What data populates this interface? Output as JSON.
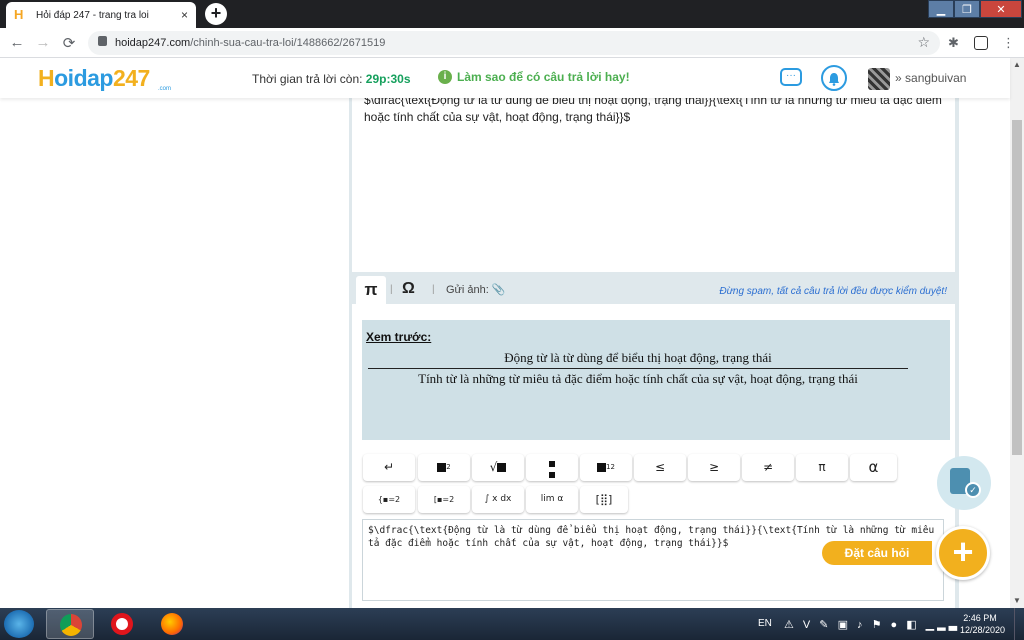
{
  "browser": {
    "tab_title": "Hỏi đáp 247 - trang tra loi",
    "tab_close": "×",
    "new_tab": "+",
    "favicon_letter": "H",
    "url_host": "hoidap247.com",
    "url_path": "/chinh-sua-cau-tra-loi/1488662/2671519",
    "back": "←",
    "forward": "→",
    "reload": "⟳",
    "star": "☆",
    "extensions": "✱",
    "menu": "⋮",
    "window_min": "▁",
    "window_max": "❐",
    "window_close": "✕"
  },
  "header": {
    "logo_h": "H",
    "logo_text": "oidap",
    "logo_num": "247",
    "logo_sub": ".com",
    "timer_label": "Thời gian trả lời còn:",
    "timer_value": "29p:30s",
    "tip_icon": "i",
    "tip_text": "Làm sao để có câu trả lời hay!",
    "chat_glyph": "···",
    "bell_glyph": "🔔",
    "username_prefix": "»",
    "username": "sangbuivan"
  },
  "editor": {
    "top_text": "$\\dfrac{\\text{Động từ là từ dùng để biểu thị hoạt động, trạng thái}}{\\text{Tính từ là những từ miêu tả đặc điểm hoặc tính chất của sự vật, hoạt động, trạng thái}}$",
    "tab_pi": "π",
    "tab_omega": "Ω",
    "sep": "|",
    "send_image_label": "Gửi ảnh:",
    "send_image_icon": "📎",
    "spam_note": "Đừng spam, tất cả câu trả lời đều được kiểm duyệt!"
  },
  "preview": {
    "label": "Xem trước:",
    "numerator": "Động từ là từ dùng để biểu thị hoạt động, trạng thái",
    "denominator": "Tính từ là những từ miêu tả đặc điểm hoặc tính chất của sự vật, hoạt động, trạng thái"
  },
  "math_buttons": {
    "newline": "↵",
    "power_sup": "2",
    "root": "√",
    "fraction": "▪",
    "subscript_sub": "12",
    "leq": "≤",
    "geq": "≥",
    "neq": "≠",
    "pi": "π",
    "alpha": "α",
    "system_eq": "{▪=2",
    "bracket_eq": "[▪=2",
    "integral": "∫ x dx",
    "limit": "lim α",
    "matrix": "[⣿]"
  },
  "latex_input": {
    "value": "$\\dfrac{\\text{Động từ là từ dùng để biểu thị hoạt động, trạng thái}}{\\text{Tính từ là những từ miêu tả đặc điểm hoặc tính chất của sự vật, hoạt động, trạng thái}}$"
  },
  "floating": {
    "ask_label": "Đặt câu hỏi",
    "ask_plus": "+",
    "check_glyph": "✓"
  },
  "scrollbar": {
    "up": "▲",
    "down": "▼"
  },
  "taskbar": {
    "lang": "EN",
    "tray": "⚠ V ✎ ▣ ♪ ⚑ ● ◧ ▁▂▃",
    "time": "2:46 PM",
    "date": "12/28/2020"
  }
}
